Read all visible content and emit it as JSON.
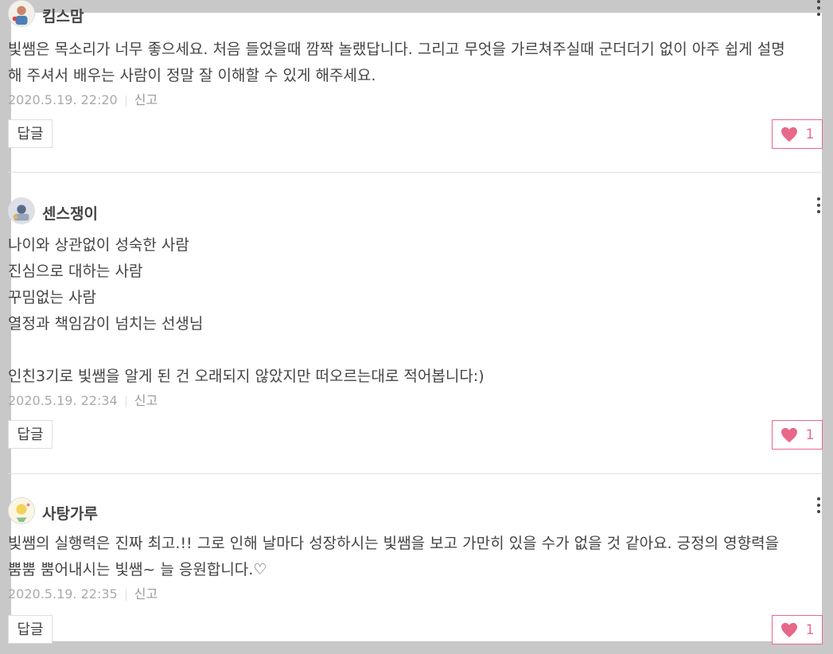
{
  "comments": [
    {
      "username": "킴스맘",
      "text": "빛쌤은 목소리가 너무 좋으세요. 처음 들었을때 깜짝 놀랬답니다. 그리고 무엇을 가르쳐주실때 군더더기 없이 아주 쉽게 설명\n해 주셔서 배우는 사람이 정말 잘 이해할 수 있게 해주세요.",
      "timestamp": "2020.5.19. 22:20",
      "report": "신고",
      "reply": "답글",
      "likes": "1",
      "avatar_icon": "user-avatar-icon"
    },
    {
      "username": "센스쟁이",
      "text": "나이와 상관없이 성숙한 사람\n진심으로 대하는 사람\n꾸밈없는 사람\n열정과 책임감이 넘치는 선생님\n\n인친3기로 빛쌤을 알게 된 건 오래되지 않았지만 떠오르는대로 적어봅니다:)",
      "timestamp": "2020.5.19. 22:34",
      "report": "신고",
      "reply": "답글",
      "likes": "1",
      "avatar_icon": "user-avatar-icon"
    },
    {
      "username": "사탕가루",
      "text": "빛쌤의 실행력은 진짜 최고.!! 그로 인해 날마다 성장하시는 빛쌤을 보고 가만히 있을 수가 없을 것 같아요. 긍정의 영향력을\n뿜뿜 뿜어내시는 빛쌤~ 늘 응원합니다.♡",
      "timestamp": "2020.5.19. 22:35",
      "report": "신고",
      "reply": "답글",
      "likes": "1",
      "avatar_icon": "user-avatar-icon"
    }
  ],
  "colors": {
    "accent": "#e8688a",
    "text": "#444444",
    "meta": "#aaaaaa",
    "background": "#c8c8c8"
  }
}
